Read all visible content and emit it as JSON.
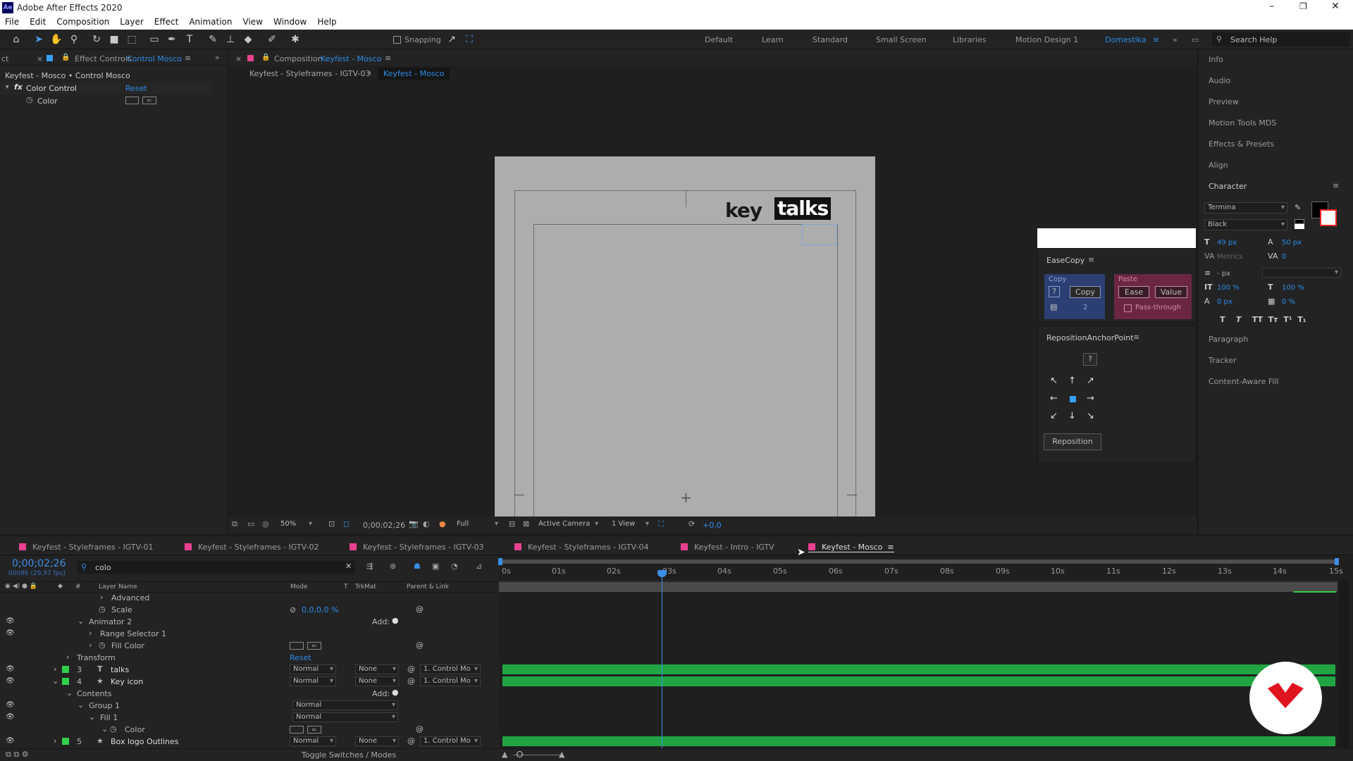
{
  "app": {
    "title": "Adobe After Effects 2020",
    "icon": "Ae"
  },
  "menu": [
    "File",
    "Edit",
    "Composition",
    "Layer",
    "Effect",
    "Animation",
    "View",
    "Window",
    "Help"
  ],
  "toolbar": {
    "snapping": "Snapping"
  },
  "workspaces": [
    "Default",
    "Learn",
    "Standard",
    "Small Screen",
    "Libraries",
    "Motion Design 1",
    "Domestika"
  ],
  "search_help": "Search Help",
  "effect_panel": {
    "tab_prefix": "ct",
    "tab_label": "Effect Controls",
    "tab_target": "Control Mosco",
    "path": "Keyfest - Mosco • Control Mosco",
    "effect_name": "Color Control",
    "reset": "Reset",
    "prop": "Color"
  },
  "comp_panel": {
    "tab_label": "Composition",
    "tab_target": "Keyfest - Mosco",
    "crumb1": "Keyfest - Styleframes - IGTV-03",
    "crumb2": "Keyfest - Mosco",
    "logo_key": "key",
    "logo_talks": "talks"
  },
  "viewer_bar": {
    "zoom": "50%",
    "time": "0;00;02;26",
    "res": "Full",
    "camera": "Active Camera",
    "views": "1 View",
    "exposure": "+0,0"
  },
  "right_panels": [
    "Info",
    "Audio",
    "Preview",
    "Motion Tools MDS",
    "Effects & Presets",
    "Align",
    "Character",
    "Paragraph",
    "Tracker",
    "Content-Aware Fill"
  ],
  "character": {
    "font": "Termina",
    "style": "Black",
    "size": "49 px",
    "leading": "50 px",
    "kerning": "Metrics",
    "tracking": "0",
    "stroke": "- px",
    "vscale": "100 %",
    "hscale": "100 %",
    "baseline": "0 px",
    "tsume": "0 %"
  },
  "easecopy": {
    "title": "EaseCopy",
    "copy_title": "Copy",
    "copy_btn": "Copy",
    "count": "2",
    "q": "?",
    "paste_title": "Paste",
    "ease_btn": "Ease",
    "value_btn": "Value",
    "passthrough": "Pass-through"
  },
  "reposition": {
    "title": "RepositionAnchorPoint",
    "q": "?",
    "button": "Reposition"
  },
  "timeline_tabs": [
    "Keyfest - Styleframes - IGTV-01",
    "Keyfest - Styleframes - IGTV-02",
    "Keyfest - Styleframes - IGTV-03",
    "Keyfest - Styleframes - IGTV-04",
    "Keyfest - Intro - IGTV",
    "Keyfest - Mosco"
  ],
  "timeline": {
    "timecode": "0;00;02;26",
    "frames": "00086 (29,97 fps)",
    "search": "colo",
    "col_layer": "Layer Name",
    "col_mode": "Mode",
    "col_t": "T",
    "col_trkmat": "TrkMat",
    "col_parent": "Parent & Link",
    "toggle": "Toggle Switches / Modes",
    "ruler": [
      "0s",
      "01s",
      "02s",
      "03s",
      "04s",
      "05s",
      "06s",
      "07s",
      "08s",
      "09s",
      "10s",
      "11s",
      "12s",
      "13s",
      "14s",
      "15s"
    ],
    "rows": {
      "advanced": "Advanced",
      "scale": "Scale",
      "scale_val": "0,0,0,0 %",
      "animator2": "Animator 2",
      "add": "Add:",
      "range": "Range Selector 1",
      "fill_color": "Fill Color",
      "transform": "Transform",
      "reset": "Reset",
      "l3_num": "3",
      "l3_name": "talks",
      "l4_num": "4",
      "l4_name": "Key icon",
      "contents": "Contents",
      "group1": "Group 1",
      "fill1": "Fill 1",
      "color": "Color",
      "l5_num": "5",
      "l5_name": "Box logo Outlines",
      "normal": "Normal",
      "none": "None",
      "parent": "1. Control Mo"
    }
  }
}
